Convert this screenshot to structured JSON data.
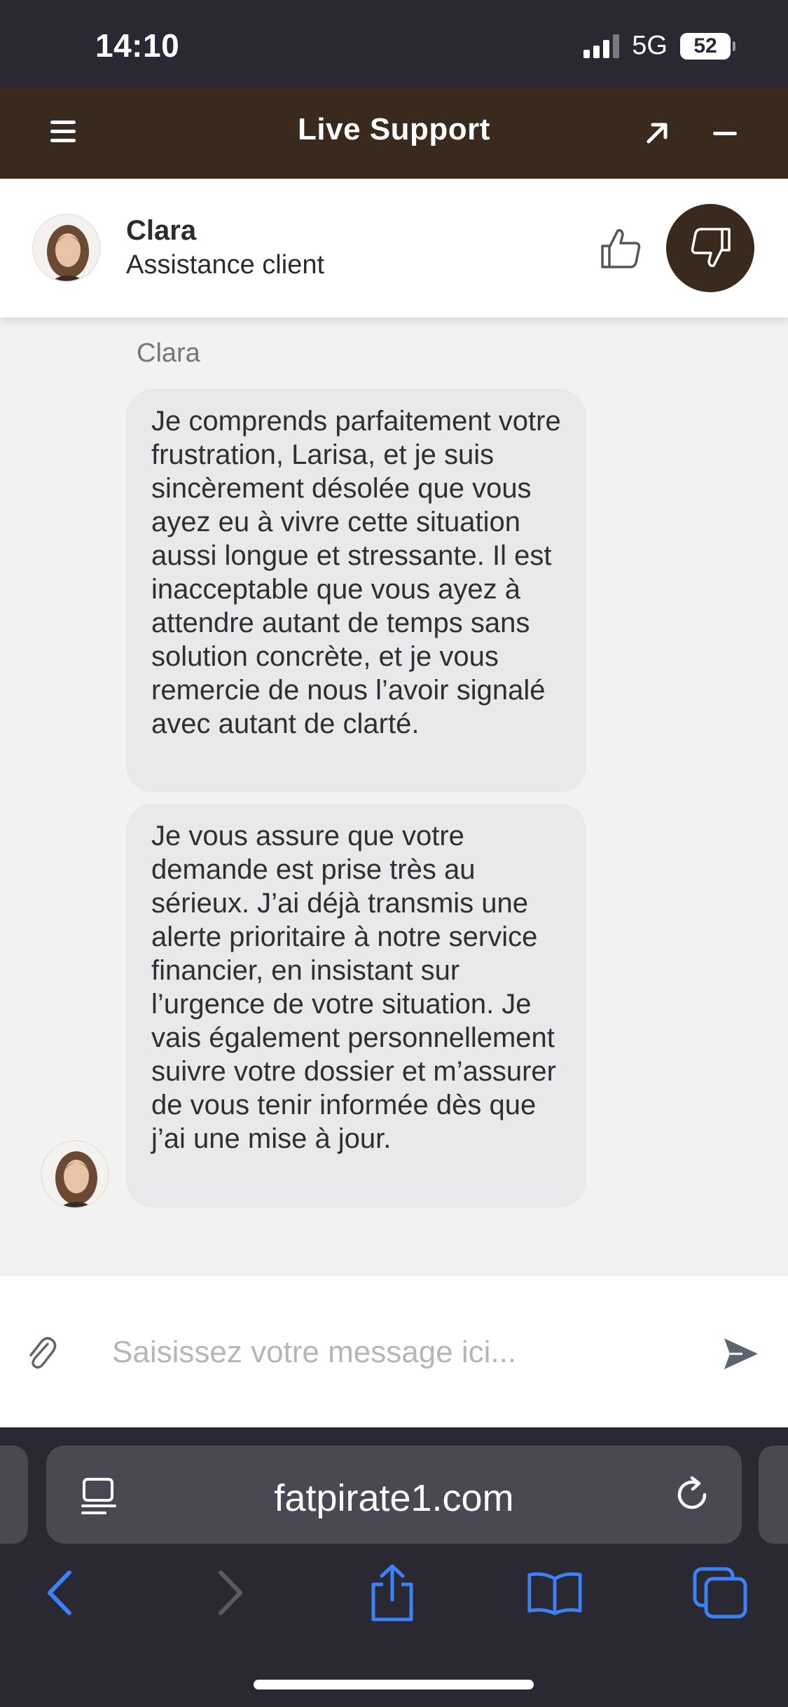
{
  "status_bar": {
    "time": "14:10",
    "network": "5G",
    "battery": "52"
  },
  "header": {
    "title": "Live Support",
    "icons": [
      "menu-icon",
      "expand-icon",
      "minimize-icon"
    ]
  },
  "agent": {
    "name": "Clara",
    "role": "Assistance client",
    "icons": [
      "thumb-up-icon",
      "thumb-down-icon"
    ]
  },
  "conversation": {
    "sender": "Clara",
    "messages": [
      {
        "text": "Je comprends parfaitement votre frustration, Larisa, et je suis sincèrement désolée que vous ayez eu à vivre cette situation aussi longue et stressante. Il est inacceptable que vous ayez à attendre autant de temps sans solution concrète, et je vous remercie de nous l’avoir signalé avec autant de clarté."
      },
      {
        "text": "Je vous assure que votre demande est prise très au sérieux. J’ai déjà transmis une alerte prioritaire à notre service financier, en insistant sur l’urgence de votre situation. Je vais également personnellement suivre votre dossier et m’assurer de vous tenir informée dès que j’ai une mise à jour."
      }
    ]
  },
  "composer": {
    "placeholder": "Saisissez votre message ici...",
    "value": ""
  },
  "browser": {
    "url": "fatpirate1.com"
  },
  "colors": {
    "header_bg": "#3a2a1e",
    "system_bg": "#2a2833",
    "bubble_bg": "#e8e9eb",
    "chat_bg": "#f2f2f3",
    "ios_blue": "#3b82f6"
  }
}
